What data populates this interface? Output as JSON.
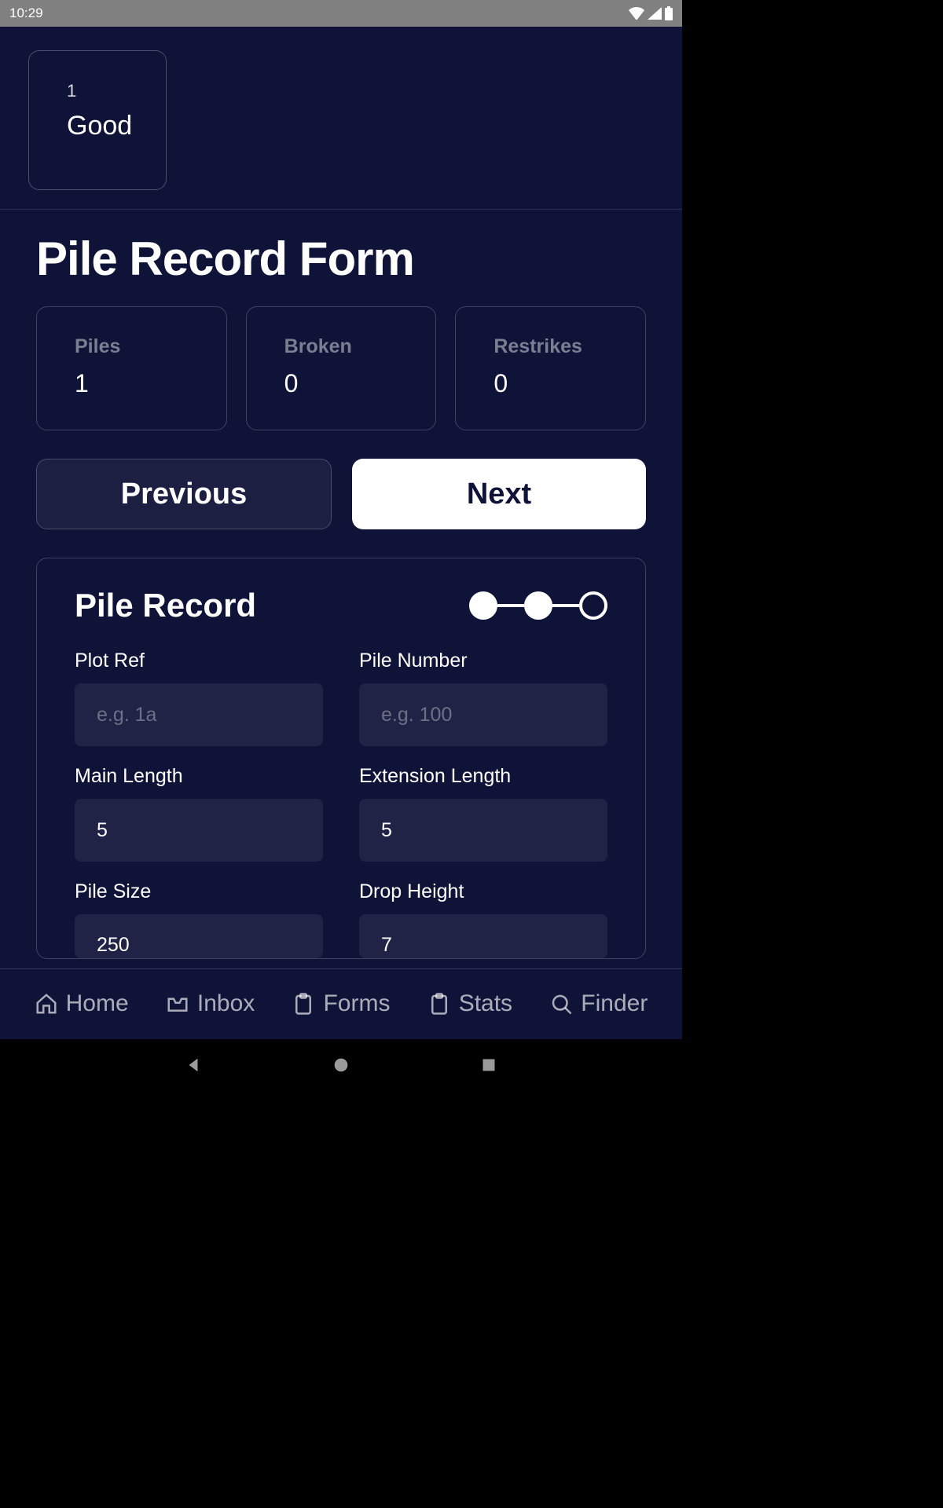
{
  "statusbar": {
    "time": "10:29"
  },
  "chip": {
    "number": "1",
    "status": "Good"
  },
  "page_title": "Pile Record Form",
  "stats": {
    "piles": {
      "label": "Piles",
      "value": "1"
    },
    "broken": {
      "label": "Broken",
      "value": "0"
    },
    "restrikes": {
      "label": "Restrikes",
      "value": "0"
    }
  },
  "nav_buttons": {
    "prev": "Previous",
    "next": "Next"
  },
  "record": {
    "title": "Pile Record",
    "steps": {
      "filled": [
        true,
        true,
        false
      ]
    },
    "fields": {
      "plot_ref": {
        "label": "Plot Ref",
        "placeholder": "e.g. 1a",
        "value": ""
      },
      "pile_number": {
        "label": "Pile Number",
        "placeholder": "e.g. 100",
        "value": ""
      },
      "main_length": {
        "label": "Main Length",
        "placeholder": "",
        "value": "5"
      },
      "ext_length": {
        "label": "Extension Length",
        "placeholder": "",
        "value": "5"
      },
      "pile_size": {
        "label": "Pile Size",
        "placeholder": "",
        "value": "250"
      },
      "drop_height": {
        "label": "Drop Height",
        "placeholder": "",
        "value": "7"
      }
    }
  },
  "bottomnav": {
    "home": "Home",
    "inbox": "Inbox",
    "forms": "Forms",
    "stats": "Stats",
    "finder": "Finder"
  }
}
